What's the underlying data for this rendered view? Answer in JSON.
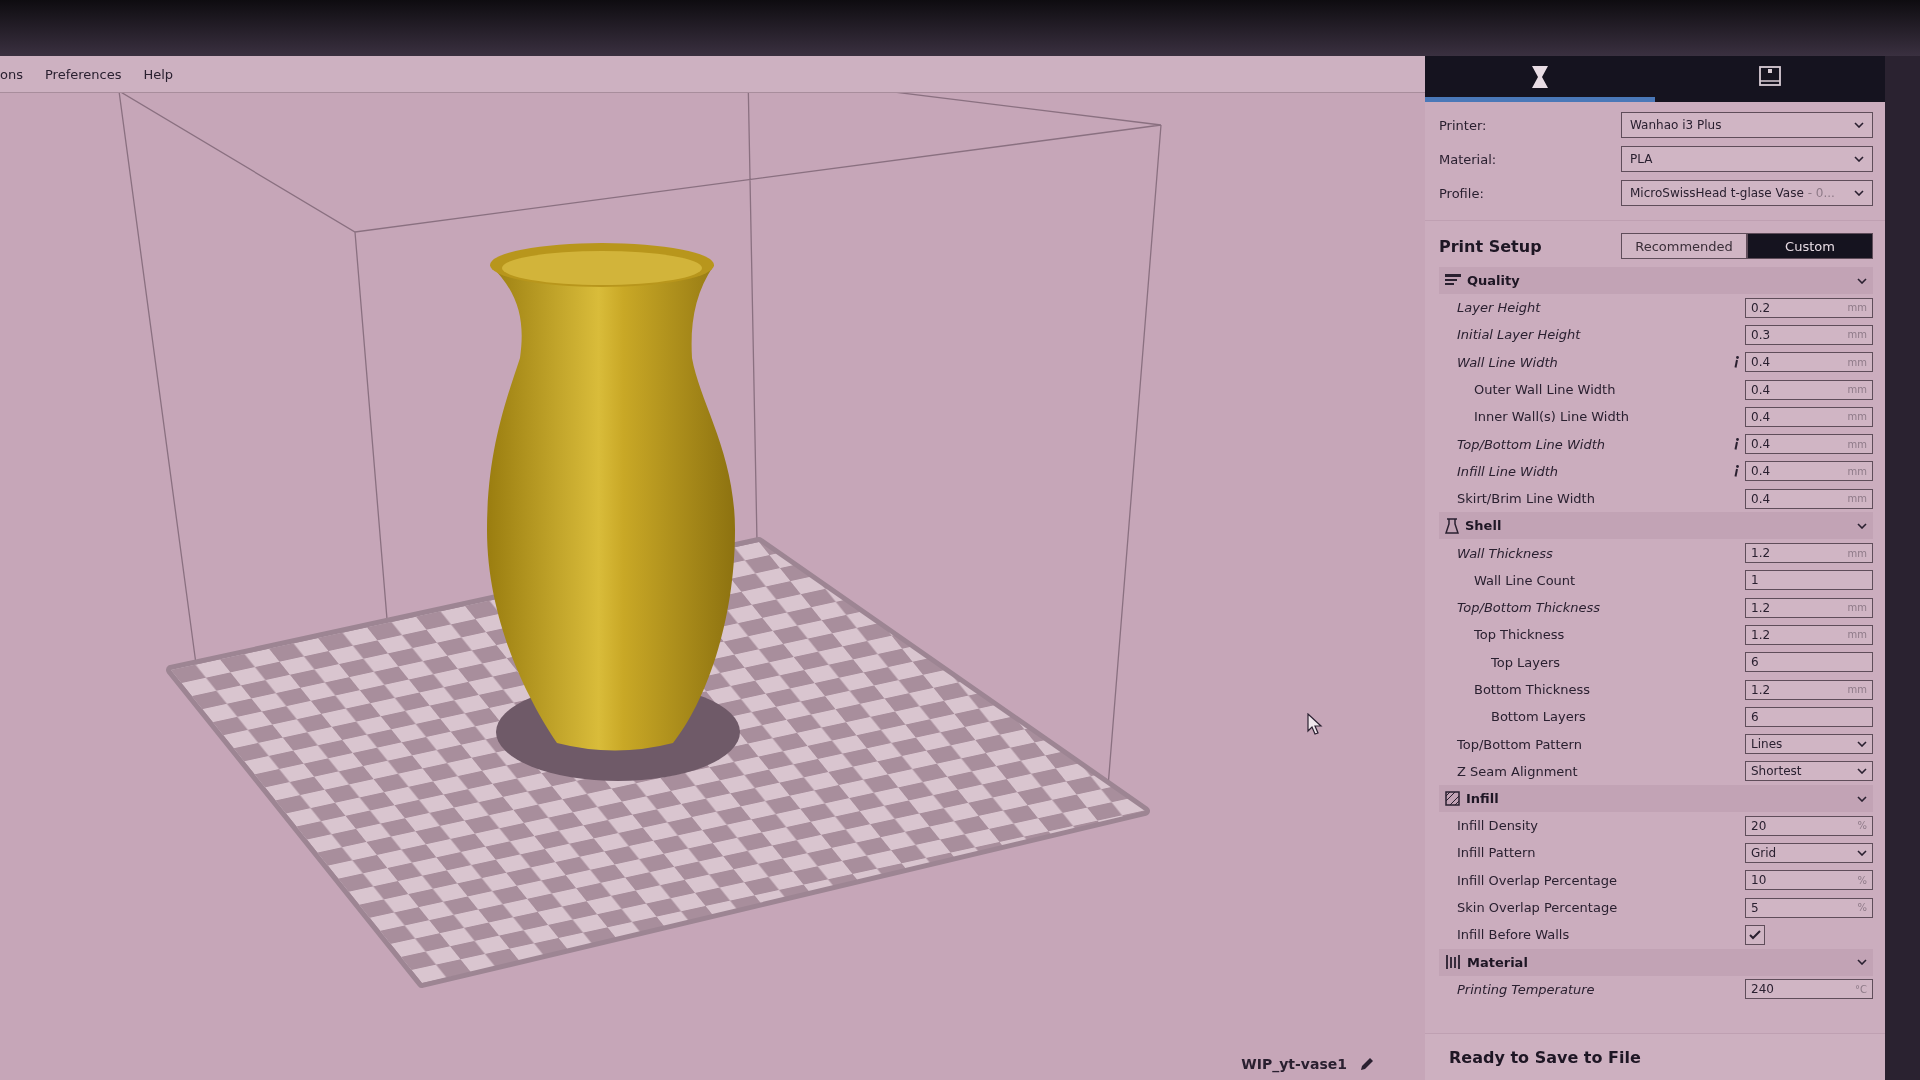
{
  "menu": [
    "ons",
    "Preferences",
    "Help"
  ],
  "viewport": {
    "file_name": "WIP_yt-vase1"
  },
  "sidebar": {
    "tabs": [
      {
        "selected": true
      },
      {
        "selected": false
      }
    ],
    "selectors": [
      {
        "label": "Printer:",
        "value": "Wanhao i3 Plus"
      },
      {
        "label": "Material:",
        "value": "PLA"
      },
      {
        "label": "Profile:",
        "value": "MicroSwissHead t-glase Vase",
        "detail": " - 0..."
      }
    ],
    "print_setup": {
      "title": "Print Setup",
      "modes": [
        {
          "label": "Recommended",
          "selected": false
        },
        {
          "label": "Custom",
          "selected": true
        }
      ]
    },
    "categories": [
      {
        "title": "Quality",
        "settings": [
          {
            "kind": "number",
            "label": "Layer Height",
            "italic": true,
            "info": false,
            "value": "0.2",
            "unit": "mm"
          },
          {
            "kind": "number",
            "label": "Initial Layer Height",
            "italic": true,
            "info": false,
            "value": "0.3",
            "unit": "mm"
          },
          {
            "kind": "number",
            "label": "Wall Line Width",
            "italic": true,
            "info": true,
            "value": "0.4",
            "unit": "mm",
            "children": [
              {
                "kind": "number",
                "label": "Outer Wall Line Width",
                "italic": false,
                "info": false,
                "value": "0.4",
                "unit": "mm"
              },
              {
                "kind": "number",
                "label": "Inner Wall(s) Line Width",
                "italic": false,
                "info": false,
                "value": "0.4",
                "unit": "mm"
              }
            ]
          },
          {
            "kind": "number",
            "label": "Top/Bottom Line Width",
            "italic": true,
            "info": true,
            "value": "0.4",
            "unit": "mm"
          },
          {
            "kind": "number",
            "label": "Infill Line Width",
            "italic": true,
            "info": true,
            "value": "0.4",
            "unit": "mm"
          },
          {
            "kind": "number",
            "label": "Skirt/Brim Line Width",
            "italic": false,
            "info": false,
            "value": "0.4",
            "unit": "mm"
          }
        ]
      },
      {
        "title": "Shell",
        "settings": [
          {
            "kind": "number",
            "label": "Wall Thickness",
            "italic": true,
            "info": false,
            "value": "1.2",
            "unit": "mm",
            "children": [
              {
                "kind": "number",
                "label": "Wall Line Count",
                "italic": false,
                "info": false,
                "value": "1"
              }
            ]
          },
          {
            "kind": "number",
            "label": "Top/Bottom Thickness",
            "italic": true,
            "info": false,
            "value": "1.2",
            "unit": "mm",
            "children": [
              {
                "kind": "number",
                "label": "Top Thickness",
                "italic": false,
                "info": false,
                "value": "1.2",
                "unit": "mm",
                "children": [
                  {
                    "kind": "number",
                    "label": "Top Layers",
                    "italic": false,
                    "info": false,
                    "value": "6"
                  }
                ]
              },
              {
                "kind": "number",
                "label": "Bottom Thickness",
                "italic": false,
                "info": false,
                "value": "1.2",
                "unit": "mm",
                "children": [
                  {
                    "kind": "number",
                    "label": "Bottom Layers",
                    "italic": false,
                    "info": false,
                    "value": "6"
                  }
                ]
              }
            ]
          },
          {
            "kind": "dropdown",
            "label": "Top/Bottom Pattern",
            "italic": false,
            "info": false,
            "value": "Lines"
          },
          {
            "kind": "dropdown",
            "label": "Z Seam Alignment",
            "italic": false,
            "info": false,
            "value": "Shortest"
          }
        ]
      },
      {
        "title": "Infill",
        "settings": [
          {
            "kind": "number",
            "label": "Infill Density",
            "italic": false,
            "info": false,
            "value": "20",
            "unit": "%"
          },
          {
            "kind": "dropdown",
            "label": "Infill Pattern",
            "italic": false,
            "info": false,
            "value": "Grid"
          },
          {
            "kind": "number",
            "label": "Infill Overlap Percentage",
            "italic": false,
            "info": false,
            "value": "10",
            "unit": "%"
          },
          {
            "kind": "number",
            "label": "Skin Overlap Percentage",
            "italic": false,
            "info": false,
            "value": "5",
            "unit": "%"
          },
          {
            "kind": "checkbox",
            "label": "Infill Before Walls",
            "italic": false,
            "info": false,
            "checked": true
          }
        ]
      },
      {
        "title": "Material",
        "settings": [
          {
            "kind": "number",
            "label": "Printing Temperature",
            "italic": true,
            "info": false,
            "value": "240",
            "unit": "°C"
          }
        ]
      }
    ],
    "status": "Ready to Save to File"
  }
}
